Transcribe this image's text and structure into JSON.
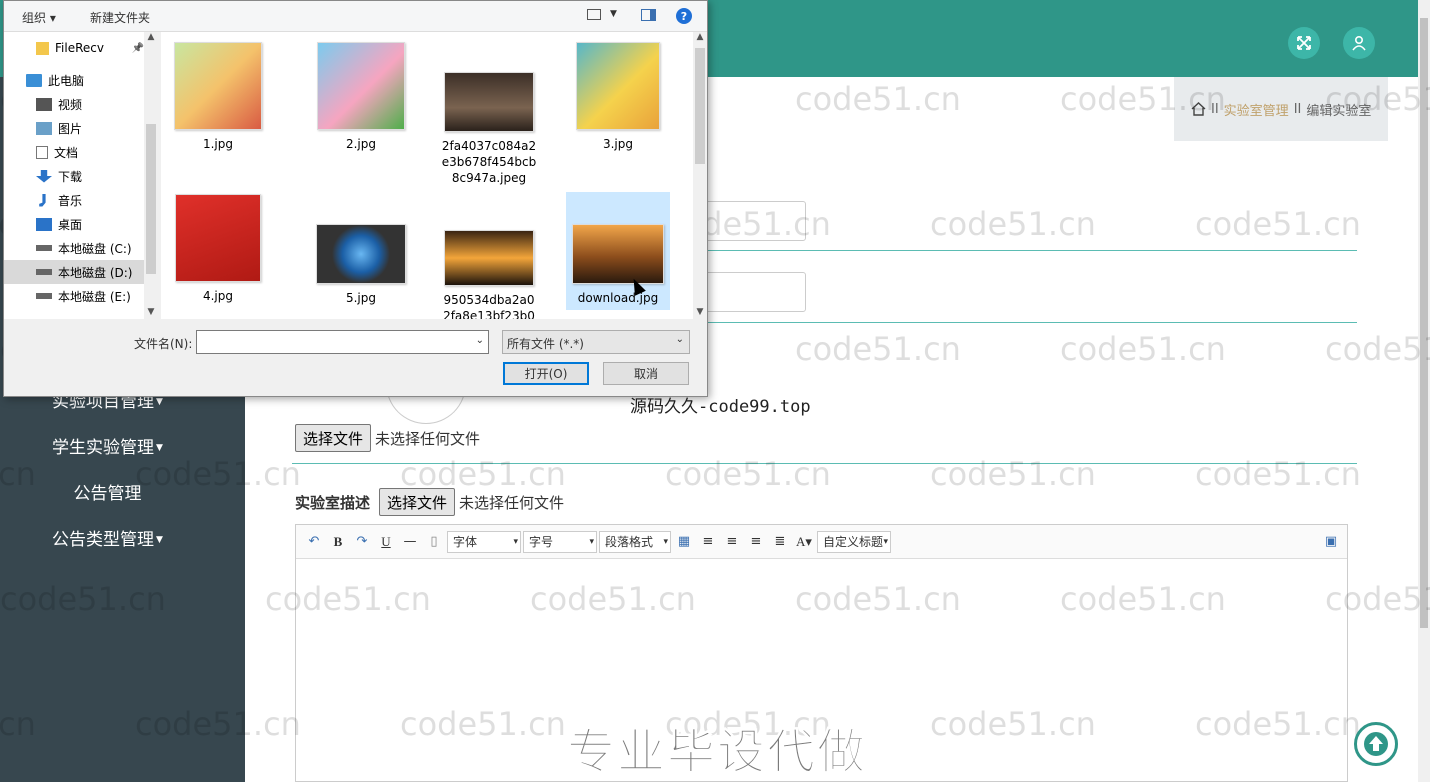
{
  "sidebar": {
    "items": [
      {
        "label": "实验项目管理",
        "caret": true
      },
      {
        "label": "学生实验管理",
        "caret": true
      },
      {
        "label": "公告管理",
        "caret": false
      },
      {
        "label": "公告类型管理",
        "caret": true
      }
    ]
  },
  "breadcrumb": {
    "sep": "II",
    "section": "实验室管理",
    "current": "编辑实验室"
  },
  "form": {
    "file1_button": "选择文件",
    "file1_status": "未选择任何文件",
    "desc_label": "实验室描述",
    "file2_button": "选择文件",
    "file2_status": "未选择任何文件"
  },
  "editor": {
    "font_select": "字体",
    "size_select": "字号",
    "para_select": "段落格式",
    "custom_title": "自定义标题"
  },
  "overlay": {
    "code_text": "源码久久-code99.top",
    "promo": "专业毕设代做",
    "watermark": "code51.cn"
  },
  "dialog": {
    "toolbar": {
      "organize": "组织 ▾",
      "new_folder": "新建文件夹"
    },
    "nav": [
      {
        "label": "FileRecv",
        "icon": "folder-icon",
        "selected": false
      },
      {
        "label": "此电脑",
        "icon": "computer-icon",
        "selected": false
      },
      {
        "label": "视频",
        "icon": "video-icon",
        "selected": false
      },
      {
        "label": "图片",
        "icon": "pictures-icon",
        "selected": false
      },
      {
        "label": "文档",
        "icon": "documents-icon",
        "selected": false
      },
      {
        "label": "下载",
        "icon": "download-icon",
        "selected": false
      },
      {
        "label": "音乐",
        "icon": "music-icon",
        "selected": false
      },
      {
        "label": "桌面",
        "icon": "desktop-icon",
        "selected": false
      },
      {
        "label": "本地磁盘 (C:)",
        "icon": "drive-icon",
        "selected": false
      },
      {
        "label": "本地磁盘 (D:)",
        "icon": "drive-icon",
        "selected": true
      },
      {
        "label": "本地磁盘 (E:)",
        "icon": "drive-icon",
        "selected": false
      }
    ],
    "files": [
      {
        "name": "1.jpg"
      },
      {
        "name": "2.jpg"
      },
      {
        "name": "2fa4037c084a2e3b678f454bcb8c947a.jpeg"
      },
      {
        "name": "3.jpg"
      },
      {
        "name": "4.jpg"
      },
      {
        "name": "5.jpg"
      },
      {
        "name": "950534dba2a02fa8e13bf23b0"
      },
      {
        "name": "download.jpg"
      }
    ],
    "filename_label": "文件名(N):",
    "filename_value": "",
    "filter_value": "所有文件 (*.*)",
    "open_button": "打开(O)",
    "cancel_button": "取消"
  },
  "colors": {
    "header": "#2f9688",
    "sidebar": "#37474f",
    "accent": "#c0a16b"
  }
}
